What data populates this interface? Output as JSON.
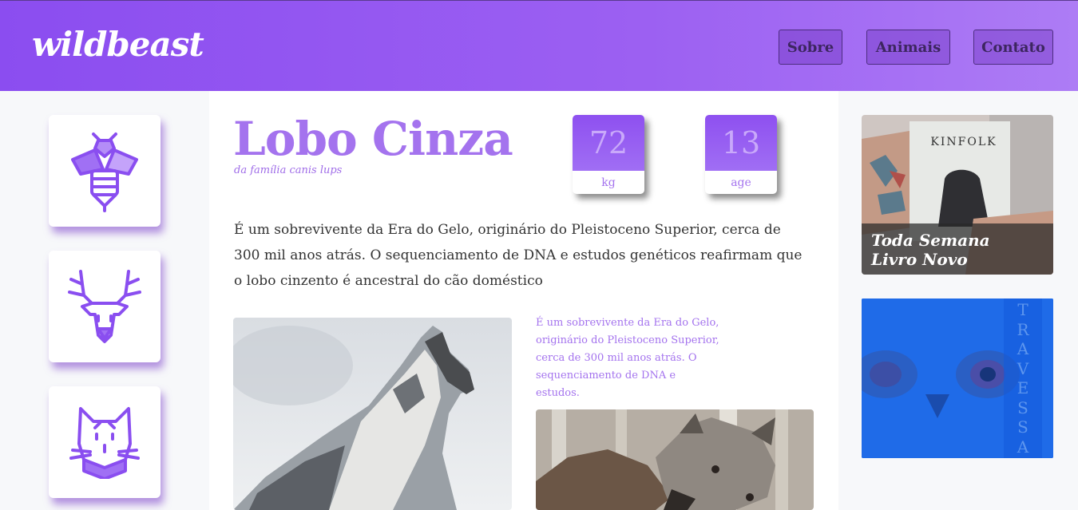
{
  "header": {
    "logo": "wildbeast",
    "nav": [
      {
        "label": "Sobre"
      },
      {
        "label": "Animais"
      },
      {
        "label": "Contato"
      }
    ]
  },
  "sidebar": {
    "icons": [
      "bee-icon",
      "deer-icon",
      "cat-icon"
    ]
  },
  "animal": {
    "name": "Lobo Cinza",
    "family": "da família canis lups",
    "stats": [
      {
        "value": "72",
        "unit": "kg"
      },
      {
        "value": "13",
        "unit": "age"
      }
    ],
    "description": "É um sobrevivente da Era do Gelo, originário do Pleistoceno Superior, cerca de 300 mil anos atrás. O sequenciamento de DNA e estudos genéticos reafirmam que o lobo cinzento é ancestral do cão doméstico",
    "side_note": "É um sobrevivente da Era do Gelo, originário do Pleistoceno Superior, cerca de 300 mil anos atrás. O sequenciamento de DNA e estudos."
  },
  "ads": [
    {
      "brand": "KINFOLK",
      "caption_line1": "Toda Semana",
      "caption_line2": "Livro Novo"
    },
    {
      "word": [
        "T",
        "R",
        "A",
        "V",
        "E",
        "S",
        "S",
        "A"
      ]
    }
  ],
  "colors": {
    "accent": "#a473ee",
    "header": "#8b4df0",
    "ad_blue": "#1f6be8"
  }
}
